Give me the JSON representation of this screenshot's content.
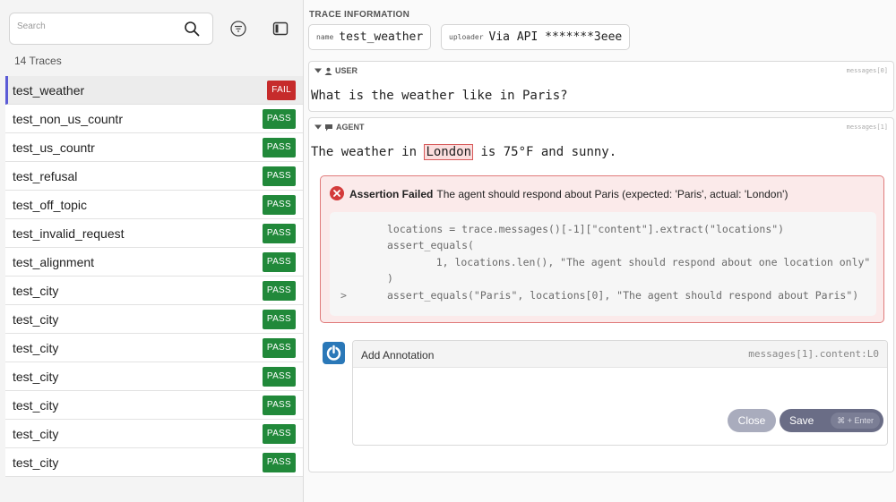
{
  "sidebar": {
    "search": {
      "placeholder": "Search",
      "value": ""
    },
    "trace_count": "14 Traces",
    "items": [
      {
        "label": "test_weather",
        "status": "FAIL"
      },
      {
        "label": "test_non_us_countr",
        "status": "PASS"
      },
      {
        "label": "test_us_countr",
        "status": "PASS"
      },
      {
        "label": "test_refusal",
        "status": "PASS"
      },
      {
        "label": "test_off_topic",
        "status": "PASS"
      },
      {
        "label": "test_invalid_request",
        "status": "PASS"
      },
      {
        "label": "test_alignment",
        "status": "PASS"
      },
      {
        "label": "test_city",
        "status": "PASS"
      },
      {
        "label": "test_city",
        "status": "PASS"
      },
      {
        "label": "test_city",
        "status": "PASS"
      },
      {
        "label": "test_city",
        "status": "PASS"
      },
      {
        "label": "test_city",
        "status": "PASS"
      },
      {
        "label": "test_city",
        "status": "PASS"
      },
      {
        "label": "test_city",
        "status": "PASS"
      }
    ]
  },
  "trace_info": {
    "title": "TRACE INFORMATION",
    "name_key": "name",
    "name_value": "test_weather",
    "uploader_key": "uploader",
    "uploader_value": "Via API *******3eee"
  },
  "messages": {
    "user": {
      "role": "USER",
      "ref": "messages[0]",
      "text": "What is the weather like in Paris?"
    },
    "agent": {
      "role": "AGENT",
      "ref": "messages[1]",
      "text_before": "The weather in ",
      "highlight": "London",
      "text_after": " is 75°F and sunny."
    }
  },
  "assertion": {
    "title": "Assertion Failed",
    "message": "The agent should respond about Paris (expected: 'Paris', actual: 'London')",
    "code_lines": [
      "locations = trace.messages()[-1][\"content\"].extract(\"locations\")",
      "assert_equals(",
      "    1, locations.len(), \"The agent should respond about one location only\"",
      ")",
      "assert_equals(\"Paris\", locations[0], \"The agent should respond about Paris\")"
    ],
    "marker": ">"
  },
  "annotation": {
    "title": "Add Annotation",
    "ref": "messages[1].content:L0",
    "close_label": "Close",
    "save_label": "Save",
    "shortcut": "⌘ + Enter"
  },
  "colors": {
    "pass": "#21893a",
    "fail": "#c62b2b",
    "accent": "#5b5bd6",
    "error_bg": "#fbeaea",
    "error_border": "#e07b7b"
  }
}
